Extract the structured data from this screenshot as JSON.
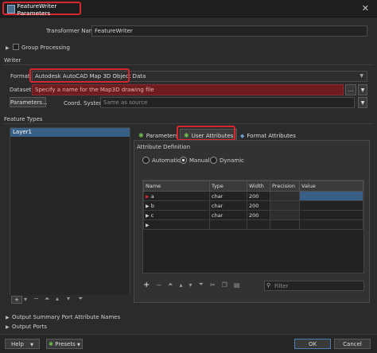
{
  "window": {
    "title": "FeatureWriter Parameters",
    "close_glyph": "✕"
  },
  "transformer_name": {
    "label": "Transformer Name:",
    "value": "FeatureWriter"
  },
  "group_processing": {
    "label": "Group Processing"
  },
  "writer": {
    "section_label": "Writer",
    "format_label": "Format:",
    "format_value": "Autodesk AutoCAD Map 3D Object Data",
    "dataset_label": "Dataset:",
    "dataset_placeholder": "Specify a name for the Map3D drawing file",
    "dataset_browse": "...",
    "parameters_button": "Parameters...",
    "coord_label": "Coord. System:",
    "coord_value": "Same as source"
  },
  "feature_types": {
    "section_label": "Feature Types",
    "items": [
      "Layer1"
    ],
    "tabs": [
      {
        "label": "Parameters",
        "icon": "gear-icon"
      },
      {
        "label": "User Attributes",
        "icon": "gear-icon"
      },
      {
        "label": "Format Attributes",
        "icon": "diamond-icon"
      }
    ],
    "attribute_definition": "Attribute Definition",
    "modes": [
      "Automatic",
      "Manual",
      "Dynamic"
    ],
    "selected_mode": "Manual",
    "columns": [
      "Name",
      "Type",
      "Width",
      "Precision",
      "Value"
    ],
    "rows": [
      {
        "name": "a",
        "type": "char",
        "width": "200",
        "precision": "",
        "value": ""
      },
      {
        "name": "b",
        "type": "char",
        "width": "200",
        "precision": "",
        "value": ""
      },
      {
        "name": "c",
        "type": "char",
        "width": "200",
        "precision": "",
        "value": ""
      }
    ],
    "filter_placeholder": "Filter"
  },
  "bottom": {
    "output_summary": "Output Summary Port Attribute Names",
    "output_ports": "Output Ports",
    "help": "Help",
    "presets": "Presets",
    "ok": "OK",
    "cancel": "Cancel"
  },
  "colors": {
    "accent_red": "#d8262c",
    "selected_blue": "#3a5f86",
    "tab_green": "#6fbf4a"
  }
}
